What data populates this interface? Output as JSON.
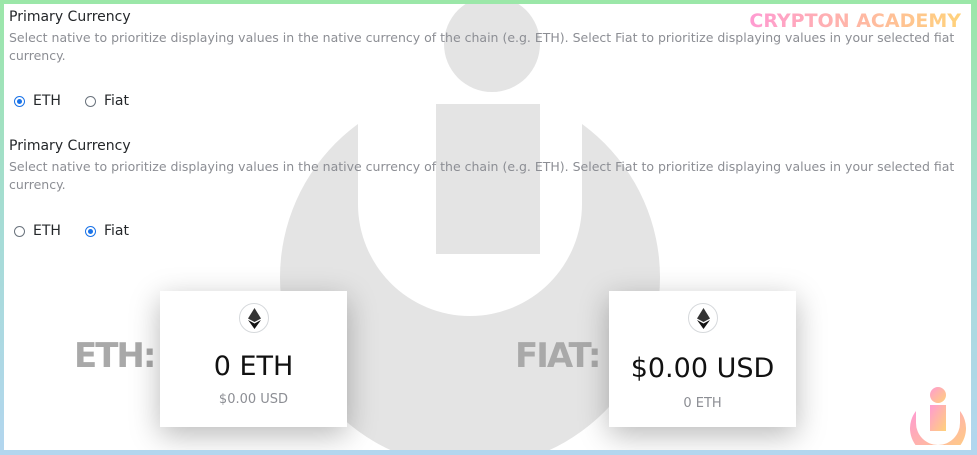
{
  "brand": {
    "text": "CRYPTON ACADEMY"
  },
  "sections": [
    {
      "title": "Primary Currency",
      "description": "Select native to prioritize displaying values in the native currency of the chain (e.g. ETH). Select Fiat to prioritize displaying values in your selected fiat currency.",
      "options": [
        {
          "label": "ETH",
          "selected": true
        },
        {
          "label": "Fiat",
          "selected": false
        }
      ]
    },
    {
      "title": "Primary Currency",
      "description": "Select native to prioritize displaying values in the native currency of the chain (e.g. ETH). Select Fiat to prioritize displaying values in your selected fiat currency.",
      "options": [
        {
          "label": "ETH",
          "selected": false
        },
        {
          "label": "Fiat",
          "selected": true
        }
      ]
    }
  ],
  "examples": [
    {
      "label": "ETH:",
      "primary": "0 ETH",
      "secondary": "$0.00 USD"
    },
    {
      "label": "FIAT:",
      "primary": "$0.00 USD",
      "secondary": "0 ETH"
    }
  ],
  "colors": {
    "accent": "#1a73e8",
    "muted": "#8c8e94",
    "watermark": "#e6e6e6"
  },
  "icons": [
    "ethereum-icon",
    "watermark-logo",
    "crypton-logo-icon"
  ]
}
